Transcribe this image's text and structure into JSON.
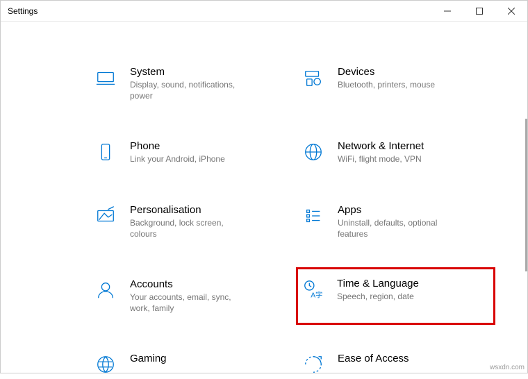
{
  "window": {
    "title": "Settings"
  },
  "tiles": [
    {
      "id": "system",
      "title": "System",
      "desc": "Display, sound, notifications, power",
      "highlight": false
    },
    {
      "id": "devices",
      "title": "Devices",
      "desc": "Bluetooth, printers, mouse",
      "highlight": false
    },
    {
      "id": "phone",
      "title": "Phone",
      "desc": "Link your Android, iPhone",
      "highlight": false
    },
    {
      "id": "network",
      "title": "Network & Internet",
      "desc": "WiFi, flight mode, VPN",
      "highlight": false
    },
    {
      "id": "personalisation",
      "title": "Personalisation",
      "desc": "Background, lock screen, colours",
      "highlight": false
    },
    {
      "id": "apps",
      "title": "Apps",
      "desc": "Uninstall, defaults, optional features",
      "highlight": false
    },
    {
      "id": "accounts",
      "title": "Accounts",
      "desc": "Your accounts, email, sync, work, family",
      "highlight": false
    },
    {
      "id": "time-language",
      "title": "Time & Language",
      "desc": "Speech, region, date",
      "highlight": true
    },
    {
      "id": "gaming",
      "title": "Gaming",
      "desc": "",
      "highlight": false
    },
    {
      "id": "ease-of-access",
      "title": "Ease of Access",
      "desc": "",
      "highlight": false
    }
  ],
  "watermark": "wsxdn.com"
}
